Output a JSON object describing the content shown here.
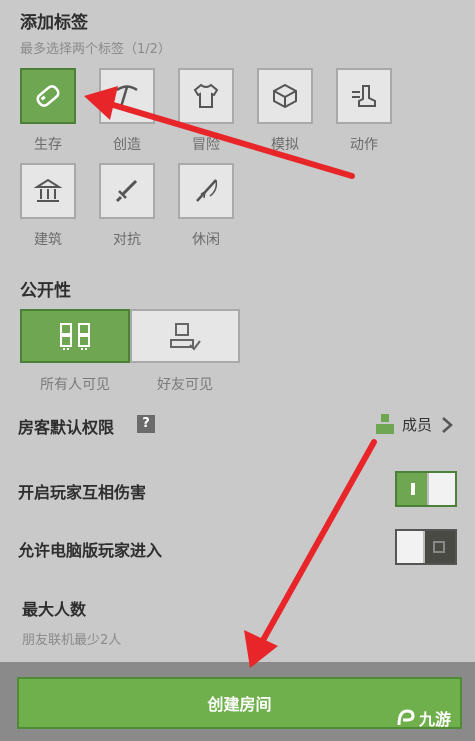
{
  "tags_section": {
    "title": "添加标签",
    "hint": "最多选择两个标签（1/2）",
    "tags": [
      {
        "label": "生存",
        "icon": "potion-icon",
        "selected": true
      },
      {
        "label": "创造",
        "icon": "pickaxe-icon",
        "selected": false
      },
      {
        "label": "冒险",
        "icon": "shirt-icon",
        "selected": false
      },
      {
        "label": "模拟",
        "icon": "cube-icon",
        "selected": false
      },
      {
        "label": "动作",
        "icon": "boot-icon",
        "selected": false
      },
      {
        "label": "建筑",
        "icon": "building-icon",
        "selected": false
      },
      {
        "label": "对抗",
        "icon": "sword-icon",
        "selected": false
      },
      {
        "label": "休闲",
        "icon": "fishing-rod-icon",
        "selected": false
      }
    ]
  },
  "visibility": {
    "title": "公开性",
    "options": [
      {
        "label": "所有人可见",
        "icon": "group-icon",
        "selected": true
      },
      {
        "label": "好友可见",
        "icon": "friend-icon",
        "selected": false
      }
    ]
  },
  "guest_permission": {
    "label": "房客默认权限",
    "help": "?",
    "value": "成员"
  },
  "pvp": {
    "label": "开启玩家互相伤害",
    "on": true
  },
  "pc_join": {
    "label": "允许电脑版玩家进入",
    "on": false
  },
  "max_players": {
    "title": "最大人数",
    "hint": "朋友联机最少2人"
  },
  "create_button": "创建房间",
  "watermark": "九游",
  "colors": {
    "accent_green": "#6ea652",
    "arrow_red": "#e8262a",
    "background": "#c9c9c9"
  }
}
